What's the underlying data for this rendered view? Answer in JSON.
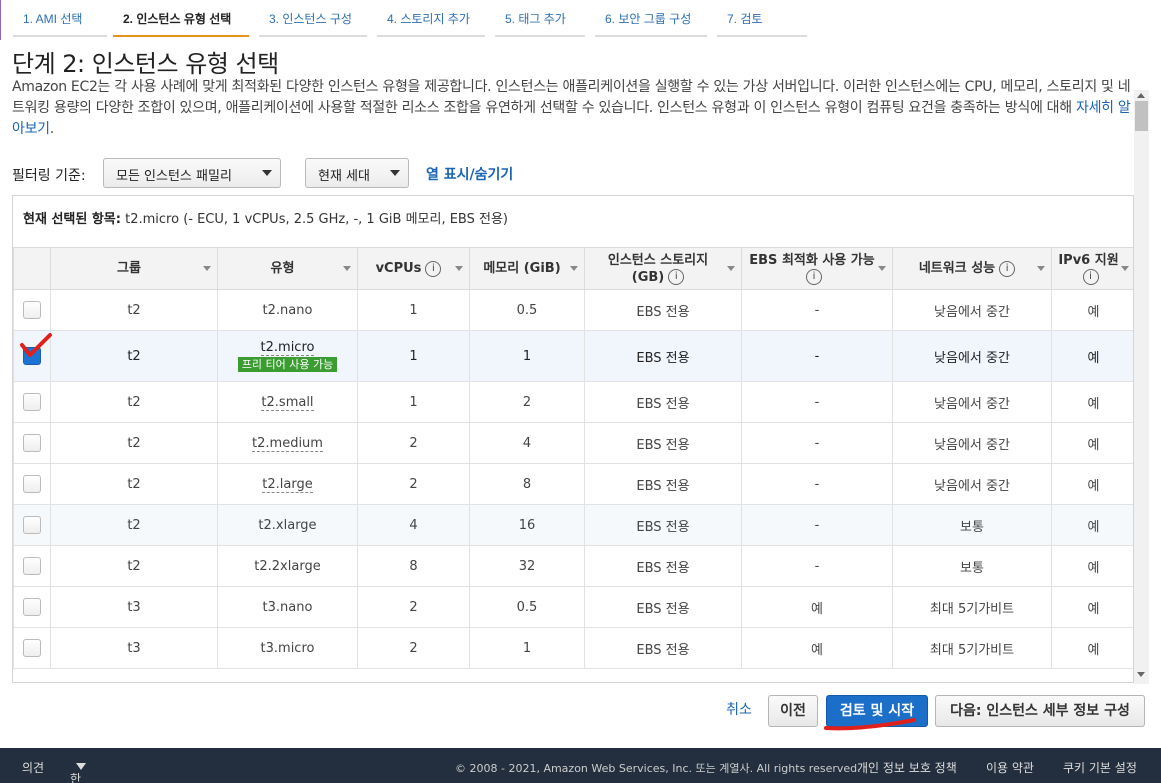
{
  "wizard_steps": [
    {
      "label": "1. AMI 선택",
      "active": false
    },
    {
      "label": "2. 인스턴스 유형 선택",
      "active": true
    },
    {
      "label": "3. 인스턴스 구성",
      "active": false
    },
    {
      "label": "4. 스토리지 추가",
      "active": false
    },
    {
      "label": "5. 태그 추가",
      "active": false
    },
    {
      "label": "6. 보안 그룹 구성",
      "active": false
    },
    {
      "label": "7. 검토",
      "active": false
    }
  ],
  "page": {
    "title": "단계 2: 인스턴스 유형 선택",
    "description": "Amazon EC2는 각 사용 사례에 맞게 최적화된 다양한 인스턴스 유형을 제공합니다. 인스턴스는 애플리케이션을 실행할 수 있는 가상 서버입니다. 이러한 인스턴스에는 CPU, 메모리, 스토리지 및 네트워킹 용량의 다양한 조합이 있으며, 애플리케이션에 사용할 적절한 리소스 조합을 유연하게 선택할 수 있습니다. 인스턴스 유형과 이 인스턴스 유형이 컴퓨팅 요건을 충족하는 방식에 대해",
    "learn_more": "자세히 알아보기",
    "period": "."
  },
  "filter": {
    "label": "필터링 기준:",
    "family_select": "모든 인스턴스 패밀리",
    "generation_select": "현재 세대",
    "toggle_columns": "열 표시/숨기기"
  },
  "selection": {
    "label": "현재 선택된 항목:",
    "value": "t2.micro (- ECU, 1 vCPUs, 2.5 GHz, -, 1 GiB 메모리, EBS 전용)"
  },
  "table": {
    "headers": [
      "그룹",
      "유형",
      "vCPUs",
      "메모리 (GiB)",
      "인스턴스 스토리지 (GB)",
      "EBS 최적화 사용 가능",
      "네트워크 성능",
      "IPv6 지원"
    ],
    "free_tier_badge": "프리 티어 사용 가능",
    "rows": [
      {
        "group": "t2",
        "type": "t2.nano",
        "vcpus": "1",
        "memory": "0.5",
        "storage": "EBS 전용",
        "ebs": "-",
        "network": "낮음에서 중간",
        "ipv6": "예",
        "selected": false
      },
      {
        "group": "t2",
        "type": "t2.micro",
        "vcpus": "1",
        "memory": "1",
        "storage": "EBS 전용",
        "ebs": "-",
        "network": "낮음에서 중간",
        "ipv6": "예",
        "selected": true
      },
      {
        "group": "t2",
        "type": "t2.small",
        "vcpus": "1",
        "memory": "2",
        "storage": "EBS 전용",
        "ebs": "-",
        "network": "낮음에서 중간",
        "ipv6": "예",
        "selected": false
      },
      {
        "group": "t2",
        "type": "t2.medium",
        "vcpus": "2",
        "memory": "4",
        "storage": "EBS 전용",
        "ebs": "-",
        "network": "낮음에서 중간",
        "ipv6": "예",
        "selected": false
      },
      {
        "group": "t2",
        "type": "t2.large",
        "vcpus": "2",
        "memory": "8",
        "storage": "EBS 전용",
        "ebs": "-",
        "network": "낮음에서 중간",
        "ipv6": "예",
        "selected": false
      },
      {
        "group": "t2",
        "type": "t2.xlarge",
        "vcpus": "4",
        "memory": "16",
        "storage": "EBS 전용",
        "ebs": "-",
        "network": "보통",
        "ipv6": "예",
        "selected": false
      },
      {
        "group": "t2",
        "type": "t2.2xlarge",
        "vcpus": "8",
        "memory": "32",
        "storage": "EBS 전용",
        "ebs": "-",
        "network": "보통",
        "ipv6": "예",
        "selected": false
      },
      {
        "group": "t3",
        "type": "t3.nano",
        "vcpus": "2",
        "memory": "0.5",
        "storage": "EBS 전용",
        "ebs": "예",
        "network": "최대 5기가비트",
        "ipv6": "예",
        "selected": false
      },
      {
        "group": "t3",
        "type": "t3.micro",
        "vcpus": "2",
        "memory": "1",
        "storage": "EBS 전용",
        "ebs": "예",
        "network": "최대 5기가비트",
        "ipv6": "예",
        "selected": false
      }
    ]
  },
  "actions": {
    "cancel": "취소",
    "previous": "이전",
    "review_launch": "검토 및 시작",
    "next": "다음: 인스턴스 세부 정보 구성"
  },
  "footer": {
    "feedback": "의견",
    "language": "한국어",
    "copyright": "© 2008 - 2021, Amazon Web Services, Inc. 또는 계열사. All rights reserved.",
    "privacy": "개인 정보 보호 정책",
    "terms": "이용 약관",
    "cookies": "쿠키 기본 설정"
  },
  "colors": {
    "primary_button": "#1c6fc9",
    "link": "#1a64b4",
    "free_tier": "#3b9c32",
    "active_step": "#e8941a",
    "footer_bg": "#232f3e",
    "annotation": "#e0201b"
  }
}
